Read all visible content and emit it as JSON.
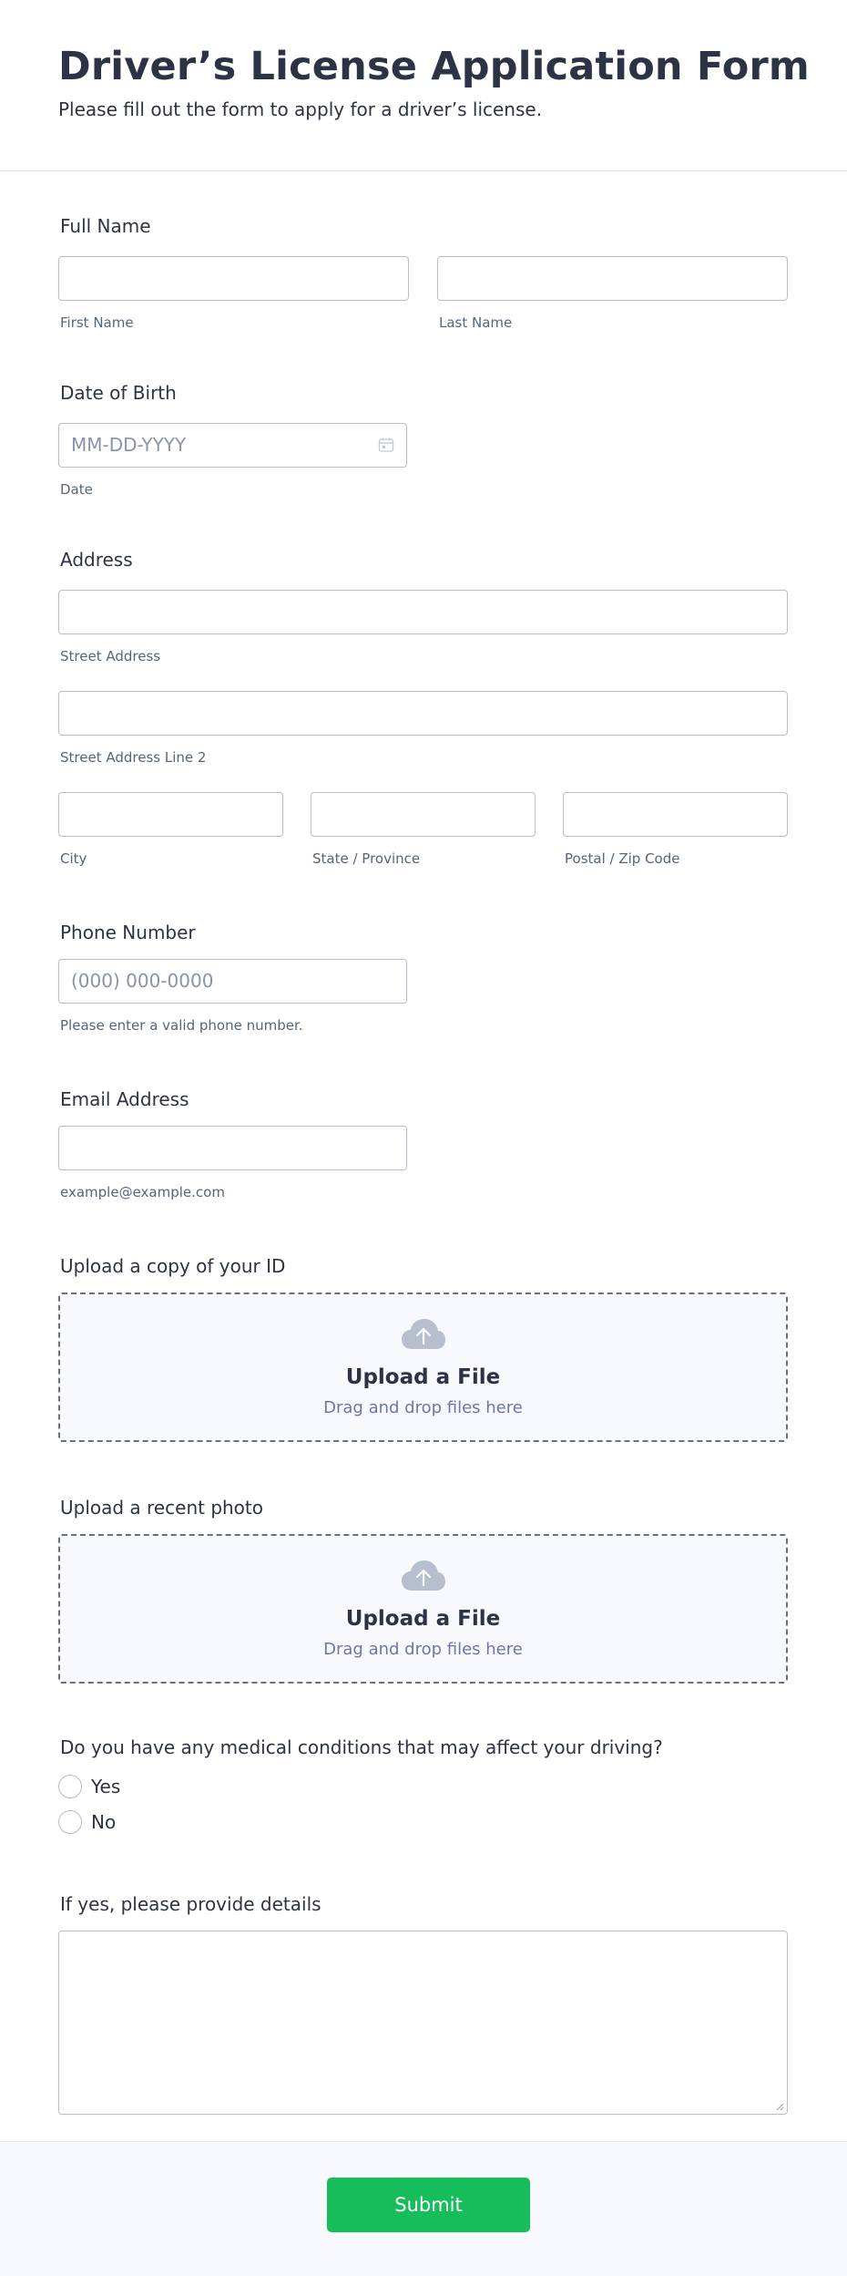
{
  "form": {
    "title": "Driver’s License Application Form",
    "subtitle": "Please fill out the form to apply for a driver’s license."
  },
  "full_name": {
    "label": "Full Name",
    "first_sublabel": "First Name",
    "last_sublabel": "Last Name"
  },
  "dob": {
    "label": "Date of Birth",
    "placeholder": "MM-DD-YYYY",
    "sublabel": "Date",
    "icon": "calendar-icon"
  },
  "address": {
    "label": "Address",
    "street_sublabel": "Street Address",
    "street2_sublabel": "Street Address Line 2",
    "city_sublabel": "City",
    "state_sublabel": "State / Province",
    "zip_sublabel": "Postal / Zip Code"
  },
  "phone": {
    "label": "Phone Number",
    "placeholder": "(000) 000-0000",
    "sublabel": "Please enter a valid phone number."
  },
  "email": {
    "label": "Email Address",
    "sublabel": "example@example.com"
  },
  "upload_id": {
    "label": "Upload a copy of your ID",
    "title": "Upload a File",
    "subtitle": "Drag and drop files here",
    "icon": "cloud-upload-icon"
  },
  "upload_photo": {
    "label": "Upload a recent photo",
    "title": "Upload a File",
    "subtitle": "Drag and drop files here",
    "icon": "cloud-upload-icon"
  },
  "medical": {
    "label": "Do you have any medical conditions that may affect your driving?",
    "options": [
      "Yes",
      "No"
    ]
  },
  "details": {
    "label": "If yes, please provide details"
  },
  "submit": {
    "label": "Submit",
    "color": "#18bd5b"
  }
}
